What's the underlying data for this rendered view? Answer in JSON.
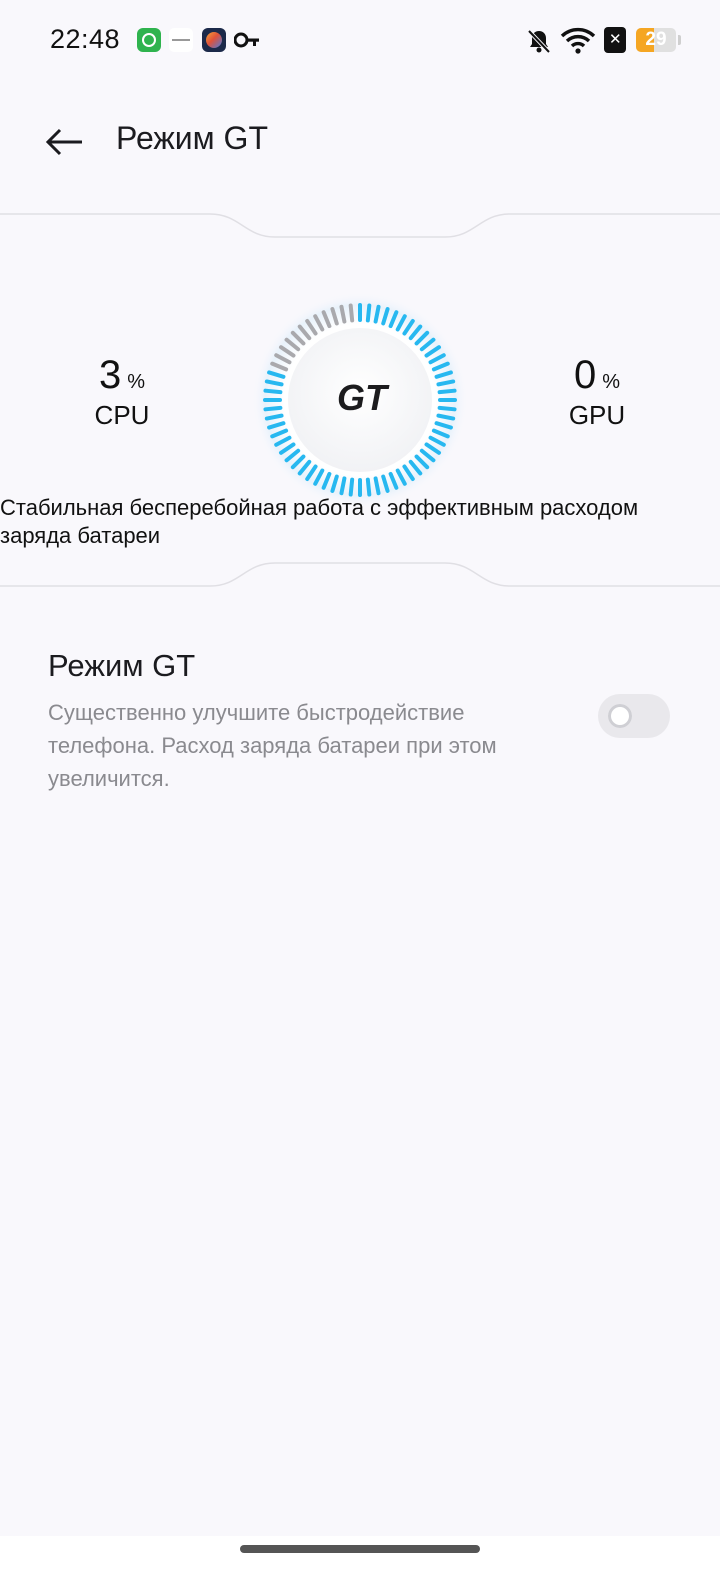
{
  "status_bar": {
    "time": "22:48",
    "battery_level": 29,
    "battery_text": "29",
    "icons": [
      "green-app-icon",
      "white-app-icon",
      "colour-app-icon",
      "key-icon",
      "muted-bell-icon",
      "wifi-icon",
      "sim-off-icon",
      "battery-icon"
    ],
    "battery_color": "#f5a623"
  },
  "header": {
    "back_icon": "arrow-left-icon",
    "title": "Режим GT"
  },
  "performance": {
    "cpu": {
      "value": "3",
      "unit": "%",
      "label": "CPU"
    },
    "gpu": {
      "value": "0",
      "unit": "%",
      "label": "GPU"
    },
    "gauge": {
      "logo_text": "GT",
      "active_fraction": 0.82,
      "active_color": "#27b8f0",
      "inactive_color": "#a9a9ad"
    },
    "description": "Стабильная бесперебойная работа с эффективным расходом заряда батареи"
  },
  "gt_mode_setting": {
    "title": "Режим GT",
    "subtitle": "Существенно улучшите быстродействие телефона. Расход заряда батареи при этом увеличится.",
    "enabled": false
  }
}
